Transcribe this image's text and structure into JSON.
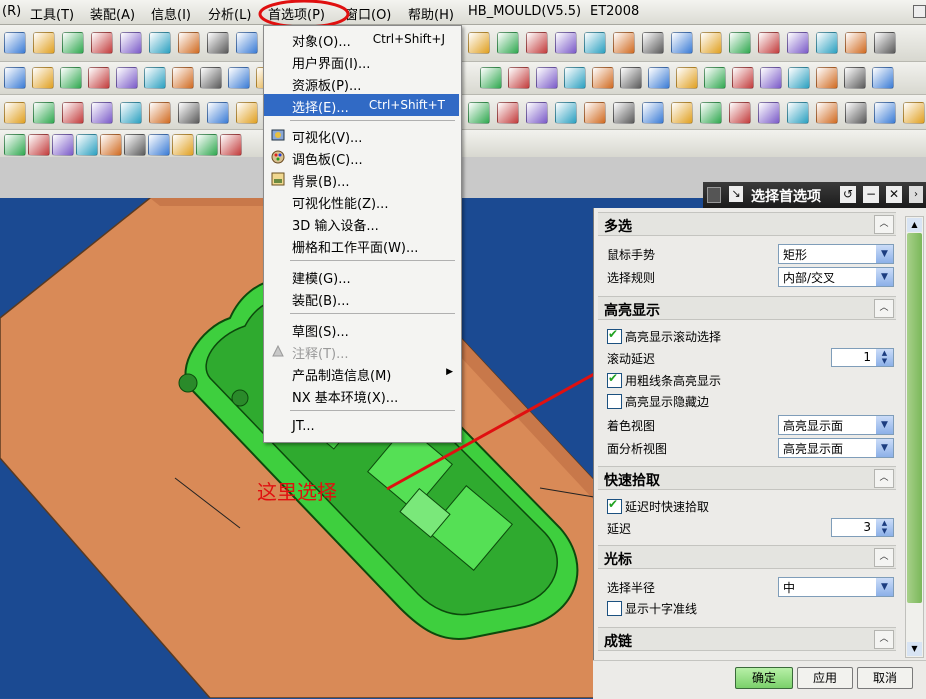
{
  "menubar": {
    "items": [
      "(R)",
      "工具(T)",
      "装配(A)",
      "信息(I)",
      "分析(L)",
      "首选项(P)",
      "窗口(O)",
      "帮助(H)",
      "HB_MOULD(V5.5)",
      "ET2008"
    ]
  },
  "dropdown": {
    "items": [
      {
        "label": "对象(O)...",
        "shortcut": "Ctrl+Shift+J"
      },
      {
        "label": "用户界面(I)...",
        "shortcut": ""
      },
      {
        "label": "资源板(P)...",
        "shortcut": ""
      },
      {
        "label": "选择(E)...",
        "shortcut": "Ctrl+Shift+T"
      },
      {
        "label": "可视化(V)...",
        "shortcut": ""
      },
      {
        "label": "调色板(C)...",
        "shortcut": ""
      },
      {
        "label": "背景(B)...",
        "shortcut": ""
      },
      {
        "label": "可视化性能(Z)...",
        "shortcut": ""
      },
      {
        "label": "3D 输入设备...",
        "shortcut": ""
      },
      {
        "label": "栅格和工作平面(W)...",
        "shortcut": ""
      },
      {
        "label": "建模(G)...",
        "shortcut": ""
      },
      {
        "label": "装配(B)...",
        "shortcut": ""
      },
      {
        "label": "草图(S)...",
        "shortcut": ""
      },
      {
        "label": "注释(T)...",
        "shortcut": ""
      },
      {
        "label": "产品制造信息(M)",
        "shortcut": ""
      },
      {
        "label": "NX 基本环境(X)...",
        "shortcut": ""
      },
      {
        "label": "JT...",
        "shortcut": ""
      }
    ]
  },
  "dialog": {
    "title": "选择首选项",
    "sections": {
      "multi": "多选",
      "highlight": "高亮显示",
      "quickpick": "快速拾取",
      "cursor": "光标",
      "chain": "成链"
    },
    "fields": {
      "mouse_gesture_label": "鼠标手势",
      "mouse_gesture_value": "矩形",
      "select_rule_label": "选择规则",
      "select_rule_value": "内部/交叉",
      "hl_rollover": "高亮显示滚动选择",
      "rollover_delay_label": "滚动延迟",
      "rollover_delay_value": "1",
      "hl_thick": "用粗线条高亮显示",
      "hl_hidden": "高亮显示隐藏边",
      "shaded_view_label": "着色视图",
      "shaded_view_value": "高亮显示面",
      "face_analysis_label": "面分析视图",
      "face_analysis_value": "高亮显示面",
      "qp_delay_check": "延迟时快速拾取",
      "qp_delay_label": "延迟",
      "qp_delay_value": "3",
      "sel_radius_label": "选择半径",
      "sel_radius_value": "中",
      "crosshair": "显示十字准线"
    },
    "buttons": {
      "ok": "确定",
      "apply": "应用",
      "cancel": "取消"
    }
  },
  "annotation": {
    "text": "这里选择"
  },
  "colors": {
    "accent": "#316ac5",
    "annotation": "#e01010",
    "part_green": "#3ecf3e",
    "plate": "#d98a57",
    "background": "#1b4a92"
  }
}
